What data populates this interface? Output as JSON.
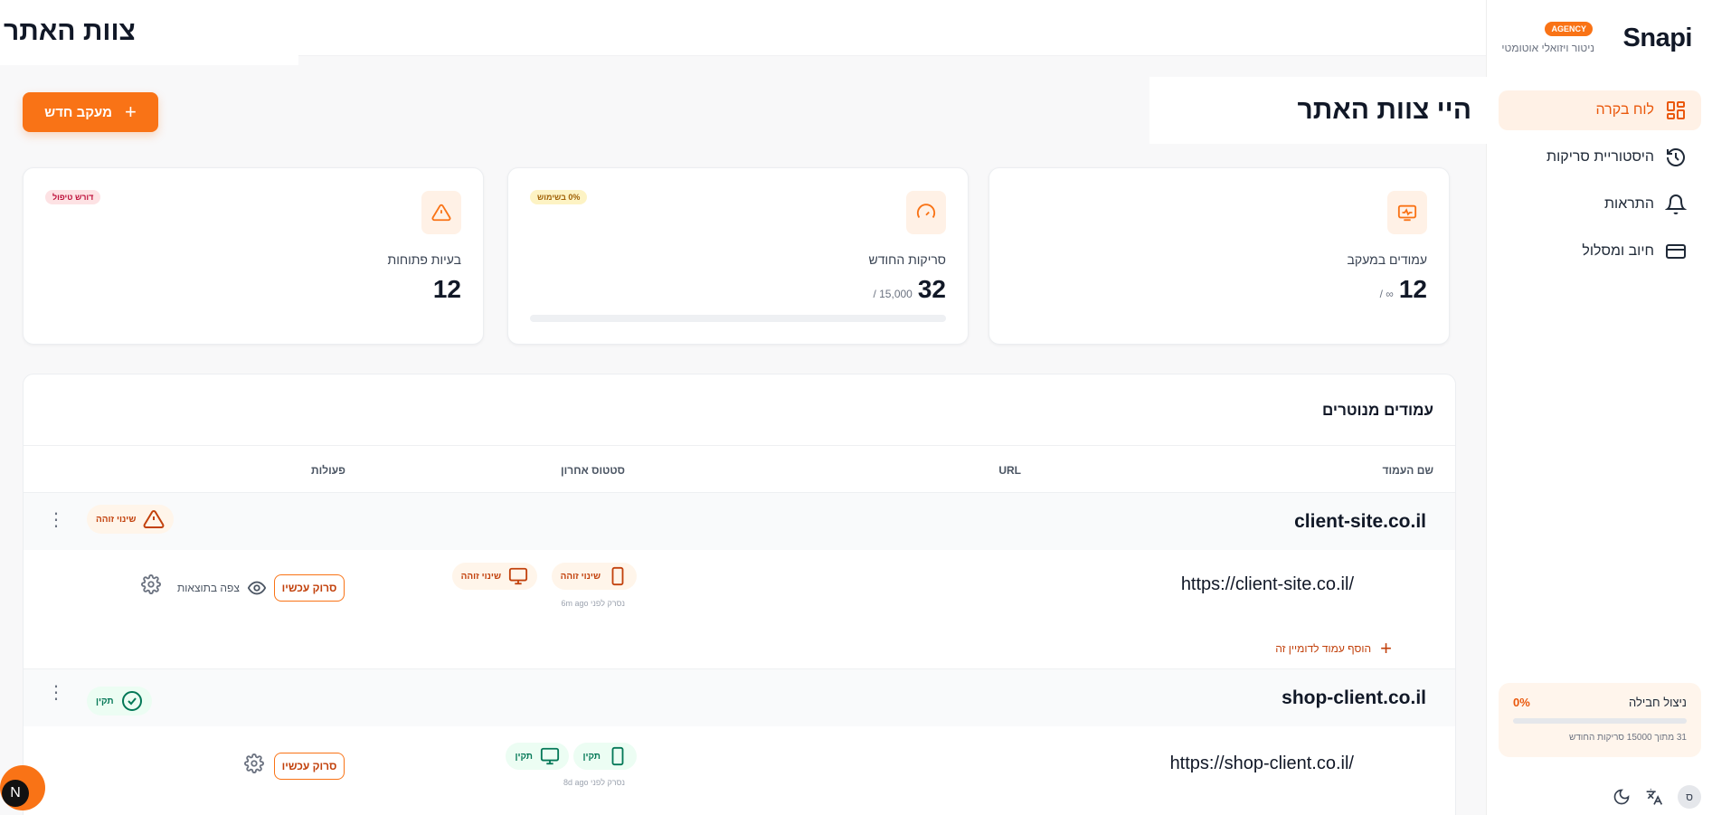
{
  "brand": {
    "name": "Snapi",
    "badge": "AGENCY",
    "subtitle": "ניטור ויזואלי אוטומטי",
    "accent": "#f97316"
  },
  "sidebar": {
    "items": [
      {
        "label": "לוח בקרה",
        "icon": "dashboard-icon",
        "active": true
      },
      {
        "label": "היסטוריית סריקות",
        "icon": "history-icon"
      },
      {
        "label": "התראות",
        "icon": "bell-icon"
      },
      {
        "label": "חיוב ומסלול",
        "icon": "credit-card-icon"
      }
    ],
    "usage": {
      "label": "ניצול חבילה",
      "percent": "0%",
      "note": "31 מתוך 15000 סריקות החודש"
    },
    "avatar_initial": "ס"
  },
  "header": {
    "title": "צוות האתר"
  },
  "new_tracking_button": "מעקב חדש",
  "greeting": "היי צוות האתר",
  "stats": [
    {
      "label": "עמודים במעקב",
      "value": "12",
      "sub": "/ ∞",
      "icon": "monitor-pulse-icon"
    },
    {
      "label": "סריקות החודש",
      "value": "32",
      "sub": "/ 15,000",
      "badge": "0% בשימוש",
      "icon": "gauge-icon",
      "progress": 0.0
    },
    {
      "label": "בעיות פתוחות",
      "value": "12",
      "badge": "דורש טיפול",
      "icon": "warning-icon"
    }
  ],
  "monitored": {
    "title": "עמודים מנוטרים",
    "columns": {
      "name": "שם העמוד",
      "url": "URL",
      "status": "סטטוס אחרון",
      "actions": "פעולות"
    },
    "groups": [
      {
        "domain": "client-site.co.il",
        "status": "שינוי זוהה",
        "pages": [
          {
            "url": "https://client-site.co.il/",
            "mobile_status": "שינוי זוהה",
            "desktop_status": "שינוי זוהה",
            "last_scan": "נסרק לפני 6m ago",
            "scan_button": "סרוק עכשיו",
            "view_link": "צפה בתוצאות"
          }
        ],
        "add_page": "הוסף עמוד לדומיין זה"
      },
      {
        "domain": "shop-client.co.il",
        "status": "תקין",
        "pages": [
          {
            "url": "https://shop-client.co.il/",
            "mobile_status": "תקין",
            "desktop_status": "תקין",
            "last_scan": "נסרק לפני 8d ago",
            "scan_button": "סרוק עכשיו"
          }
        ]
      }
    ]
  },
  "next_badge": "N"
}
